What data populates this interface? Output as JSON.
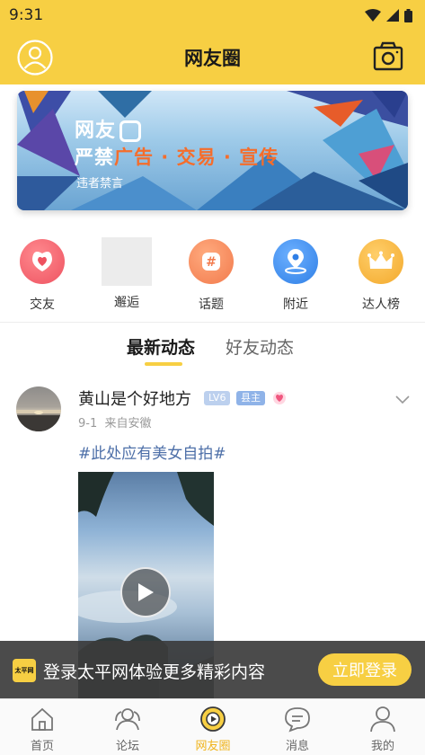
{
  "status_bar": {
    "time": "9:31"
  },
  "header": {
    "title": "网友圈"
  },
  "banner": {
    "title": "网友",
    "strip_prefix": "严禁",
    "strip_items": "广告 · 交易 · 宣传",
    "subtitle": "违者禁言"
  },
  "categories": [
    {
      "label": "交友",
      "icon": "heart-chat-icon",
      "color": "#f0616b"
    },
    {
      "label": "邂逅",
      "icon": "image-placeholder",
      "color": "#ececec"
    },
    {
      "label": "话题",
      "icon": "hashtag-icon",
      "color": "#f58a5a"
    },
    {
      "label": "附近",
      "icon": "location-pin-icon",
      "color": "#3f8ef0"
    },
    {
      "label": "达人榜",
      "icon": "crown-icon",
      "color": "#f5b53d"
    }
  ],
  "feed_tabs": [
    {
      "label": "最新动态",
      "active": true
    },
    {
      "label": "好友动态",
      "active": false
    }
  ],
  "post": {
    "author": "黄山是个好地方",
    "level_badge": "LV6",
    "role_badge": "县主",
    "date": "9-1",
    "location": "来自安徽",
    "tagline": "#此处应有美女自拍#"
  },
  "login_prompt": {
    "logo_text": "太平网",
    "message": "登录太平网体验更多精彩内容",
    "button": "立即登录"
  },
  "tabbar": [
    {
      "label": "首页",
      "icon": "home-icon",
      "active": false
    },
    {
      "label": "论坛",
      "icon": "forum-icon",
      "active": false
    },
    {
      "label": "网友圈",
      "icon": "friends-circle-icon",
      "active": true
    },
    {
      "label": "消息",
      "icon": "message-icon",
      "active": false
    },
    {
      "label": "我的",
      "icon": "profile-icon",
      "active": false
    }
  ],
  "colors": {
    "brand_yellow": "#f7cf43",
    "link_blue": "#4d6fa8"
  }
}
